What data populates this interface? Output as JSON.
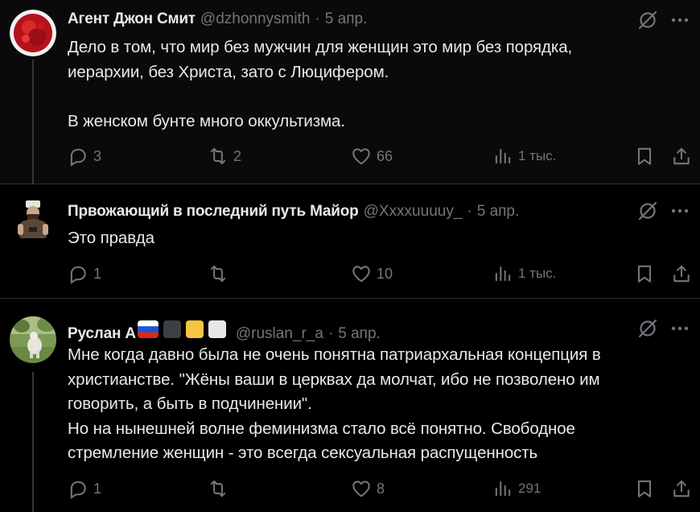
{
  "posts": [
    {
      "name": "Агент Джон Смит",
      "handle": "@dzhonnysmith",
      "separator": "·",
      "date": "5 апр.",
      "text": "Дело в том, что мир без мужчин для женщин это мир без порядка,\nиерархии, без Христа, зато с Люцифером.\n\nВ женском бунте много оккультизма.",
      "replies": "3",
      "reposts": "2",
      "likes": "66",
      "views": "1 тыс."
    },
    {
      "name": "Првожающий в последний путь Майор",
      "handle": "@Xxxxuuuuy_",
      "separator": "·",
      "date": "5 апр.",
      "text": "Это правда",
      "replies": "1",
      "reposts": "",
      "likes": "10",
      "views": "1 тыс."
    },
    {
      "name": "Руслан А",
      "handle": "@ruslan_r_a",
      "separator": "·",
      "date": "5 апр.",
      "text": "Мне когда давно была не очень понятна патриархальная концепция в\nхристианстве. \"Жёны ваши в церквах да молчат, ибо не позволено им\nговорить, а быть в подчинении\".\nНо на нынешней волне феминизма стало всё понятно. Свободное\nстремление женщин - это всегда сексуальная распущенность",
      "replies": "1",
      "reposts": "",
      "likes": "8",
      "views": "291"
    }
  ],
  "icons": {
    "reply": "reply-icon",
    "repost": "repost-icon",
    "like": "heart-icon",
    "views": "views-chart-icon",
    "bookmark": "bookmark-icon",
    "share": "share-icon",
    "grok": "grok-icon",
    "more": "more-icon"
  },
  "colors": {
    "background": "#000000",
    "text": "#e7e9ea",
    "muted": "#71767b",
    "divider": "#2f3336"
  }
}
